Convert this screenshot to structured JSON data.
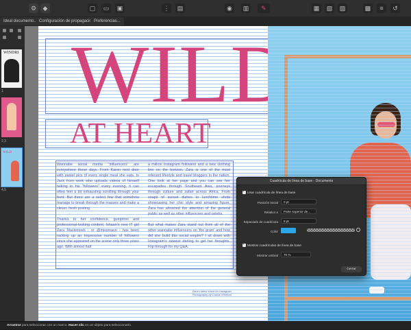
{
  "tabs": [
    "Ideal documento...",
    "Configuración de propagación...",
    "Preferencias..."
  ],
  "pages": [
    "1",
    "2,3",
    "4,5"
  ],
  "thumb_text": {
    "wild_small": "WILD",
    "logo": "WINDRI"
  },
  "spread": {
    "title": "WILD",
    "subtitle": "AT HEART",
    "column1": "Wannabe social media \"influencers\" are everywhere these days. From Karen next door with pastel pics of every single meal she eats, to Jack from work who uploads videos of himself talking to his \"followers\" every evening, it can often feel a bit exhausting scrolling through your feed. But there are a select few that somehow manage to break through the masses and make a clever, fresh posting.\n\nThanks to her confidence, gumption and professional-looking content, Ishaan's new IT girl Zara Mackintosh - or @missmarzi - has been racking up an impressive number of followers since she appeared on the scene only three years ago. With almost half",
    "column2": "a million Instagram followers and a new clothing line on the horizon, Zara is one of the most relevant lifestyle and travel bloggers in the nation. One look at her page and you can see her escapades through Southeast Asia, journeys through culture and safari across Africa. From snaps of sunset dishes to lunchtime shots showcasing her chic style and amazing figure, Zara has attracted the attention of the general public as well as other influencers and celebs.\n\nBut what makes Zara stand out from all of the other wannabe influencers on 'the gram' and how did she build this social empire? I sit down with Instagram's newest darling to get her thoughts. Flip through for my Q&A.",
    "caption": "Zara's latest shoot for Instagram\nPhotography by Cassie Whitford"
  },
  "dialog": {
    "title": "Cuadrícula de línea de base - Documento",
    "use_grid_label": "Usar cuadrícula de línea de base",
    "start_label": "Posición inicial",
    "start_value": "0 pt",
    "relative_label": "Relativo a",
    "relative_value": "Parte superior de...",
    "spacing_label": "Espaciado de cuadrícula",
    "spacing_value": "8 pt",
    "color_label": "Color",
    "color_value": "#2aa7e8",
    "show_grid_label": "Mostrar cuadrículas de línea de base",
    "threshold_label": "Mostrar umbral",
    "threshold_value": "70 %",
    "close_label": "Cerrar"
  },
  "status": {
    "key1": "Arrastrar",
    "text1": " para seleccionar con un marco. ",
    "key2": "Hacer clic",
    "text2": " en un objeto para seleccionarlo."
  }
}
